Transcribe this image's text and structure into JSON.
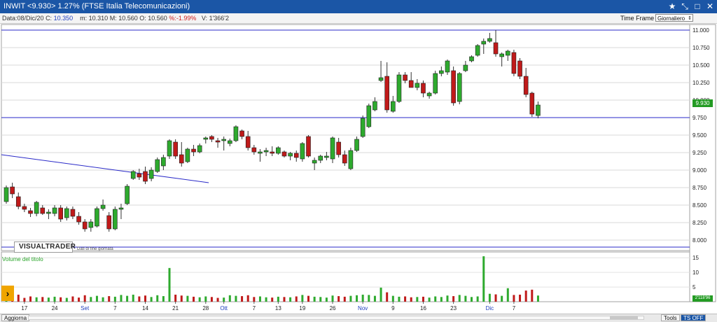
{
  "window": {
    "title": "INWIT <9.930> 1.27%  (FTSE Italia Telecomunicazioni)",
    "icons": [
      "star-icon",
      "collapse-icon",
      "maximize-icon",
      "close-icon"
    ]
  },
  "info": {
    "data_label": "Data:08/Dic/20",
    "close_label": "C:",
    "close_value": "10.350",
    "min_label": "m:",
    "min_value": "10.310",
    "max_label": "M:",
    "max_value": "10.560",
    "open_label": "O:",
    "open_value": "10.560",
    "var_value": "%:-1.99%",
    "volume_label": "V:",
    "volume_value": "1'366'2"
  },
  "timeframe": {
    "label": "Time Frame",
    "selected": "Giornaliero"
  },
  "logo": {
    "text": "VISUALTRADER",
    "subtitle": "Dati di fine giornata"
  },
  "volume_panel_label": "Volume del titolo",
  "last_price_label": "9.930",
  "last_volume_label": "2'118'96",
  "bottom": {
    "update_button": "Aggiorna",
    "tools_button": "Tools",
    "ts_button": "TS OFF"
  },
  "colors": {
    "up": "#2eaa2e",
    "down": "#c01a1a",
    "trendline": "#2a2ac8",
    "titlebar": "#1b56a6"
  },
  "chart_data": {
    "type": "candlestick",
    "price_axis": {
      "range": [
        7.85,
        11.08
      ],
      "ticks": [
        "11.000",
        "10.750",
        "10.500",
        "10.250",
        "10.000",
        "9.750",
        "9.500",
        "9.250",
        "9.000",
        "8.750",
        "8.500",
        "8.250",
        "8.000"
      ]
    },
    "volume_axis": {
      "range": [
        0,
        16
      ],
      "ticks": [
        "15",
        "10",
        "5"
      ]
    },
    "x_ticks": [
      {
        "label": "17",
        "index": 3
      },
      {
        "label": "24",
        "index": 8
      },
      {
        "label": "Set",
        "index": 13,
        "month": true
      },
      {
        "label": "7",
        "index": 18
      },
      {
        "label": "14",
        "index": 23
      },
      {
        "label": "21",
        "index": 28
      },
      {
        "label": "28",
        "index": 33
      },
      {
        "label": "Ott",
        "index": 36,
        "month": true
      },
      {
        "label": "7",
        "index": 41
      },
      {
        "label": "13",
        "index": 45
      },
      {
        "label": "19",
        "index": 49
      },
      {
        "label": "26",
        "index": 54
      },
      {
        "label": "Nov",
        "index": 59,
        "month": true
      },
      {
        "label": "9",
        "index": 64
      },
      {
        "label": "16",
        "index": 69
      },
      {
        "label": "23",
        "index": 74
      },
      {
        "label": "Dic",
        "index": 80,
        "month": true
      },
      {
        "label": "7",
        "index": 84
      }
    ],
    "horizontal_lines": [
      11.0,
      9.75,
      7.9
    ],
    "trendline": {
      "from": {
        "index": 0,
        "price": 9.22
      },
      "to": {
        "index": 33.5,
        "price": 8.82
      }
    },
    "candles": [
      {
        "o": 8.55,
        "h": 8.78,
        "l": 8.52,
        "c": 8.75,
        "v": 2.1
      },
      {
        "o": 8.76,
        "h": 8.82,
        "l": 8.6,
        "c": 8.66,
        "v": 1.6
      },
      {
        "o": 8.62,
        "h": 8.68,
        "l": 8.44,
        "c": 8.48,
        "v": 2.4
      },
      {
        "o": 8.48,
        "h": 8.52,
        "l": 8.4,
        "c": 8.44,
        "v": 1.3
      },
      {
        "o": 8.42,
        "h": 8.46,
        "l": 8.33,
        "c": 8.38,
        "v": 1.8
      },
      {
        "o": 8.38,
        "h": 8.56,
        "l": 8.34,
        "c": 8.54,
        "v": 1.5
      },
      {
        "o": 8.46,
        "h": 8.5,
        "l": 8.36,
        "c": 8.38,
        "v": 1.6
      },
      {
        "o": 8.38,
        "h": 8.44,
        "l": 8.3,
        "c": 8.4,
        "v": 1.4
      },
      {
        "o": 8.38,
        "h": 8.5,
        "l": 8.34,
        "c": 8.46,
        "v": 1.7
      },
      {
        "o": 8.46,
        "h": 8.5,
        "l": 8.26,
        "c": 8.3,
        "v": 1.5
      },
      {
        "o": 8.32,
        "h": 8.48,
        "l": 8.28,
        "c": 8.45,
        "v": 1.3
      },
      {
        "o": 8.44,
        "h": 8.48,
        "l": 8.3,
        "c": 8.34,
        "v": 1.8
      },
      {
        "o": 8.34,
        "h": 8.4,
        "l": 8.22,
        "c": 8.26,
        "v": 1.4
      },
      {
        "o": 8.26,
        "h": 8.3,
        "l": 8.12,
        "c": 8.16,
        "v": 2.2
      },
      {
        "o": 8.18,
        "h": 8.3,
        "l": 8.12,
        "c": 8.26,
        "v": 1.6
      },
      {
        "o": 8.2,
        "h": 8.48,
        "l": 8.18,
        "c": 8.45,
        "v": 2.0
      },
      {
        "o": 8.45,
        "h": 8.58,
        "l": 8.42,
        "c": 8.5,
        "v": 1.5
      },
      {
        "o": 8.35,
        "h": 8.4,
        "l": 8.12,
        "c": 8.16,
        "v": 1.9
      },
      {
        "o": 8.16,
        "h": 8.48,
        "l": 8.14,
        "c": 8.44,
        "v": 1.7
      },
      {
        "o": 8.44,
        "h": 8.52,
        "l": 8.3,
        "c": 8.46,
        "v": 2.3
      },
      {
        "o": 8.52,
        "h": 8.8,
        "l": 8.5,
        "c": 8.77,
        "v": 2.0
      },
      {
        "o": 8.88,
        "h": 9.0,
        "l": 8.86,
        "c": 8.98,
        "v": 2.4
      },
      {
        "o": 8.95,
        "h": 9.02,
        "l": 8.86,
        "c": 8.9,
        "v": 1.8
      },
      {
        "o": 8.98,
        "h": 9.05,
        "l": 8.8,
        "c": 8.84,
        "v": 2.1
      },
      {
        "o": 8.88,
        "h": 9.04,
        "l": 8.84,
        "c": 9.0,
        "v": 1.6
      },
      {
        "o": 8.98,
        "h": 9.18,
        "l": 8.96,
        "c": 9.15,
        "v": 2.2
      },
      {
        "o": 9.06,
        "h": 9.22,
        "l": 9.0,
        "c": 9.18,
        "v": 1.9
      },
      {
        "o": 9.2,
        "h": 9.44,
        "l": 9.16,
        "c": 9.42,
        "v": 11.5
      },
      {
        "o": 9.4,
        "h": 9.44,
        "l": 9.16,
        "c": 9.2,
        "v": 2.4
      },
      {
        "o": 9.22,
        "h": 9.4,
        "l": 9.05,
        "c": 9.1,
        "v": 2.1
      },
      {
        "o": 9.12,
        "h": 9.32,
        "l": 9.1,
        "c": 9.3,
        "v": 2.0
      },
      {
        "o": 9.3,
        "h": 9.36,
        "l": 9.2,
        "c": 9.26,
        "v": 1.7
      },
      {
        "o": 9.26,
        "h": 9.38,
        "l": 9.24,
        "c": 9.35,
        "v": 1.5
      },
      {
        "o": 9.44,
        "h": 9.48,
        "l": 9.38,
        "c": 9.46,
        "v": 1.8
      },
      {
        "o": 9.48,
        "h": 9.5,
        "l": 9.4,
        "c": 9.44,
        "v": 1.6
      },
      {
        "o": 9.42,
        "h": 9.46,
        "l": 9.32,
        "c": 9.4,
        "v": 1.3
      },
      {
        "o": 9.42,
        "h": 9.48,
        "l": 9.28,
        "c": 9.44,
        "v": 1.4
      },
      {
        "o": 9.38,
        "h": 9.45,
        "l": 9.34,
        "c": 9.42,
        "v": 2.2
      },
      {
        "o": 9.42,
        "h": 9.64,
        "l": 9.4,
        "c": 9.62,
        "v": 2.0
      },
      {
        "o": 9.56,
        "h": 9.58,
        "l": 9.44,
        "c": 9.48,
        "v": 1.9
      },
      {
        "o": 9.48,
        "h": 9.56,
        "l": 9.28,
        "c": 9.32,
        "v": 2.2
      },
      {
        "o": 9.32,
        "h": 9.36,
        "l": 9.22,
        "c": 9.26,
        "v": 1.6
      },
      {
        "o": 9.24,
        "h": 9.3,
        "l": 9.12,
        "c": 9.26,
        "v": 1.8
      },
      {
        "o": 9.26,
        "h": 9.32,
        "l": 9.2,
        "c": 9.28,
        "v": 1.5
      },
      {
        "o": 9.26,
        "h": 9.34,
        "l": 9.2,
        "c": 9.24,
        "v": 1.4
      },
      {
        "o": 9.24,
        "h": 9.34,
        "l": 9.22,
        "c": 9.32,
        "v": 1.7
      },
      {
        "o": 9.26,
        "h": 9.28,
        "l": 9.18,
        "c": 9.2,
        "v": 1.6
      },
      {
        "o": 9.2,
        "h": 9.26,
        "l": 9.14,
        "c": 9.24,
        "v": 1.5
      },
      {
        "o": 9.24,
        "h": 9.28,
        "l": 9.12,
        "c": 9.18,
        "v": 1.8
      },
      {
        "o": 9.16,
        "h": 9.4,
        "l": 9.12,
        "c": 9.38,
        "v": 2.3
      },
      {
        "o": 9.48,
        "h": 9.5,
        "l": 9.18,
        "c": 9.2,
        "v": 2.0
      },
      {
        "o": 9.1,
        "h": 9.18,
        "l": 9.0,
        "c": 9.14,
        "v": 1.7
      },
      {
        "o": 9.14,
        "h": 9.22,
        "l": 9.1,
        "c": 9.2,
        "v": 1.6
      },
      {
        "o": 9.18,
        "h": 9.26,
        "l": 9.14,
        "c": 9.2,
        "v": 1.4
      },
      {
        "o": 9.16,
        "h": 9.48,
        "l": 9.1,
        "c": 9.46,
        "v": 2.1
      },
      {
        "o": 9.4,
        "h": 9.46,
        "l": 9.18,
        "c": 9.22,
        "v": 1.9
      },
      {
        "o": 9.22,
        "h": 9.28,
        "l": 9.06,
        "c": 9.1,
        "v": 1.7
      },
      {
        "o": 9.02,
        "h": 9.32,
        "l": 9.0,
        "c": 9.28,
        "v": 2.0
      },
      {
        "o": 9.28,
        "h": 9.48,
        "l": 9.26,
        "c": 9.44,
        "v": 2.2
      },
      {
        "o": 9.48,
        "h": 9.78,
        "l": 9.46,
        "c": 9.74,
        "v": 2.4
      },
      {
        "o": 9.62,
        "h": 9.95,
        "l": 9.6,
        "c": 9.92,
        "v": 2.3
      },
      {
        "o": 9.86,
        "h": 10.04,
        "l": 9.84,
        "c": 9.98,
        "v": 2.0
      },
      {
        "o": 10.28,
        "h": 10.56,
        "l": 10.26,
        "c": 10.32,
        "v": 4.8
      },
      {
        "o": 10.34,
        "h": 10.54,
        "l": 9.82,
        "c": 9.86,
        "v": 3.2
      },
      {
        "o": 9.84,
        "h": 10.06,
        "l": 9.82,
        "c": 9.98,
        "v": 2.0
      },
      {
        "o": 9.98,
        "h": 10.4,
        "l": 9.96,
        "c": 10.36,
        "v": 1.7
      },
      {
        "o": 10.36,
        "h": 10.4,
        "l": 10.24,
        "c": 10.28,
        "v": 1.8
      },
      {
        "o": 10.28,
        "h": 10.4,
        "l": 10.2,
        "c": 10.18,
        "v": 1.5
      },
      {
        "o": 10.18,
        "h": 10.3,
        "l": 10.14,
        "c": 10.24,
        "v": 1.6
      },
      {
        "o": 10.24,
        "h": 10.28,
        "l": 10.04,
        "c": 10.1,
        "v": 1.7
      },
      {
        "o": 10.06,
        "h": 10.12,
        "l": 10.02,
        "c": 10.1,
        "v": 1.4
      },
      {
        "o": 10.1,
        "h": 10.42,
        "l": 10.08,
        "c": 10.38,
        "v": 1.8
      },
      {
        "o": 10.38,
        "h": 10.48,
        "l": 10.34,
        "c": 10.42,
        "v": 1.6
      },
      {
        "o": 10.4,
        "h": 10.58,
        "l": 10.36,
        "c": 10.56,
        "v": 2.1
      },
      {
        "o": 10.42,
        "h": 10.48,
        "l": 9.92,
        "c": 9.96,
        "v": 1.9
      },
      {
        "o": 9.98,
        "h": 10.4,
        "l": 9.94,
        "c": 10.38,
        "v": 2.3
      },
      {
        "o": 10.42,
        "h": 10.56,
        "l": 10.4,
        "c": 10.5,
        "v": 2.0
      },
      {
        "o": 10.56,
        "h": 10.64,
        "l": 10.54,
        "c": 10.62,
        "v": 1.6
      },
      {
        "o": 10.64,
        "h": 10.8,
        "l": 10.62,
        "c": 10.78,
        "v": 1.8
      },
      {
        "o": 10.8,
        "h": 10.88,
        "l": 10.66,
        "c": 10.84,
        "v": 15.5
      },
      {
        "o": 10.84,
        "h": 10.96,
        "l": 10.82,
        "c": 10.88,
        "v": 2.7
      },
      {
        "o": 10.82,
        "h": 11.0,
        "l": 10.62,
        "c": 10.66,
        "v": 2.5
      },
      {
        "o": 10.62,
        "h": 10.68,
        "l": 10.48,
        "c": 10.66,
        "v": 2.0
      },
      {
        "o": 10.64,
        "h": 10.72,
        "l": 10.56,
        "c": 10.7,
        "v": 4.6
      },
      {
        "o": 10.68,
        "h": 10.72,
        "l": 10.34,
        "c": 10.38,
        "v": 2.3
      },
      {
        "o": 10.56,
        "h": 10.6,
        "l": 10.3,
        "c": 10.34,
        "v": 2.4
      },
      {
        "o": 10.34,
        "h": 10.46,
        "l": 10.04,
        "c": 10.08,
        "v": 3.8
      },
      {
        "o": 10.1,
        "h": 10.12,
        "l": 9.76,
        "c": 9.8,
        "v": 4.1
      },
      {
        "o": 9.78,
        "h": 9.98,
        "l": 9.74,
        "c": 9.93,
        "v": 2.1
      }
    ]
  }
}
